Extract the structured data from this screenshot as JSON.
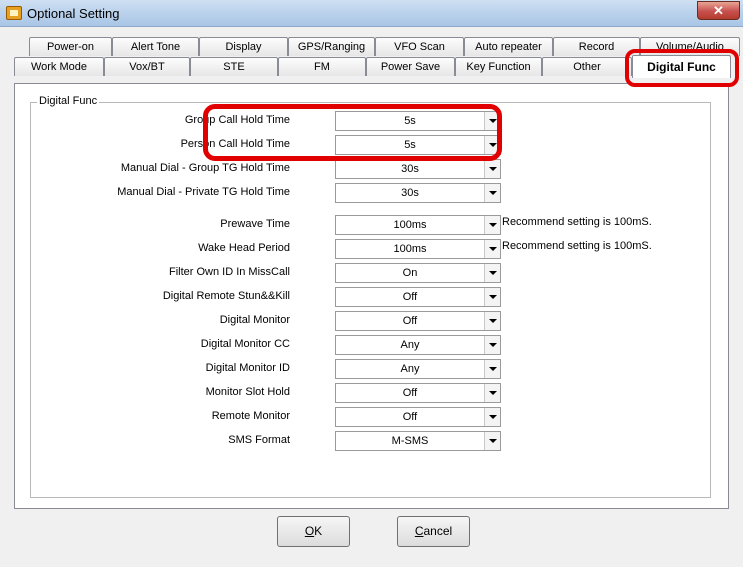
{
  "window": {
    "title": "Optional Setting",
    "close_glyph": "✕",
    "icon": "app-icon"
  },
  "tabs_row1": [
    "Power-on",
    "Alert Tone",
    "Display",
    "GPS/Ranging",
    "VFO Scan",
    "Auto repeater",
    "Record",
    "Volume/Audio"
  ],
  "tabs_row2": [
    "Work Mode",
    "Vox/BT",
    "STE",
    "FM",
    "Power Save",
    "Key Function",
    "Other",
    "Digital Func"
  ],
  "active_tab": "Digital Func",
  "group": {
    "title": "Digital Func"
  },
  "settings": [
    {
      "label": "Group Call Hold Time",
      "value": "5s",
      "note": ""
    },
    {
      "label": "Person Call Hold Time",
      "value": "5s",
      "note": ""
    },
    {
      "label": "Manual Dial - Group TG Hold Time",
      "value": "30s",
      "note": ""
    },
    {
      "label": "Manual Dial - Private TG Hold Time",
      "value": "30s",
      "note": ""
    },
    {
      "label": "Prewave Time",
      "value": "100ms",
      "note": "Recommend setting is 100mS."
    },
    {
      "label": "Wake Head Period",
      "value": "100ms",
      "note": "Recommend setting is 100mS."
    },
    {
      "label": "Filter Own ID In MissCall",
      "value": "On",
      "note": ""
    },
    {
      "label": "Digital Remote Stun&&Kill",
      "value": "Off",
      "note": ""
    },
    {
      "label": "Digital Monitor",
      "value": "Off",
      "note": ""
    },
    {
      "label": "Digital Monitor CC",
      "value": "Any",
      "note": ""
    },
    {
      "label": "Digital Monitor ID",
      "value": "Any",
      "note": ""
    },
    {
      "label": "Monitor Slot Hold",
      "value": "Off",
      "note": ""
    },
    {
      "label": "Remote Monitor",
      "value": "Off",
      "note": ""
    },
    {
      "label": "SMS Format",
      "value": "M-SMS",
      "note": ""
    }
  ],
  "buttons": {
    "ok": {
      "mnemonic": "O",
      "rest": "K"
    },
    "cancel": {
      "mnemonic": "C",
      "rest": "ancel"
    }
  },
  "colors": {
    "highlight": "#e00000"
  }
}
